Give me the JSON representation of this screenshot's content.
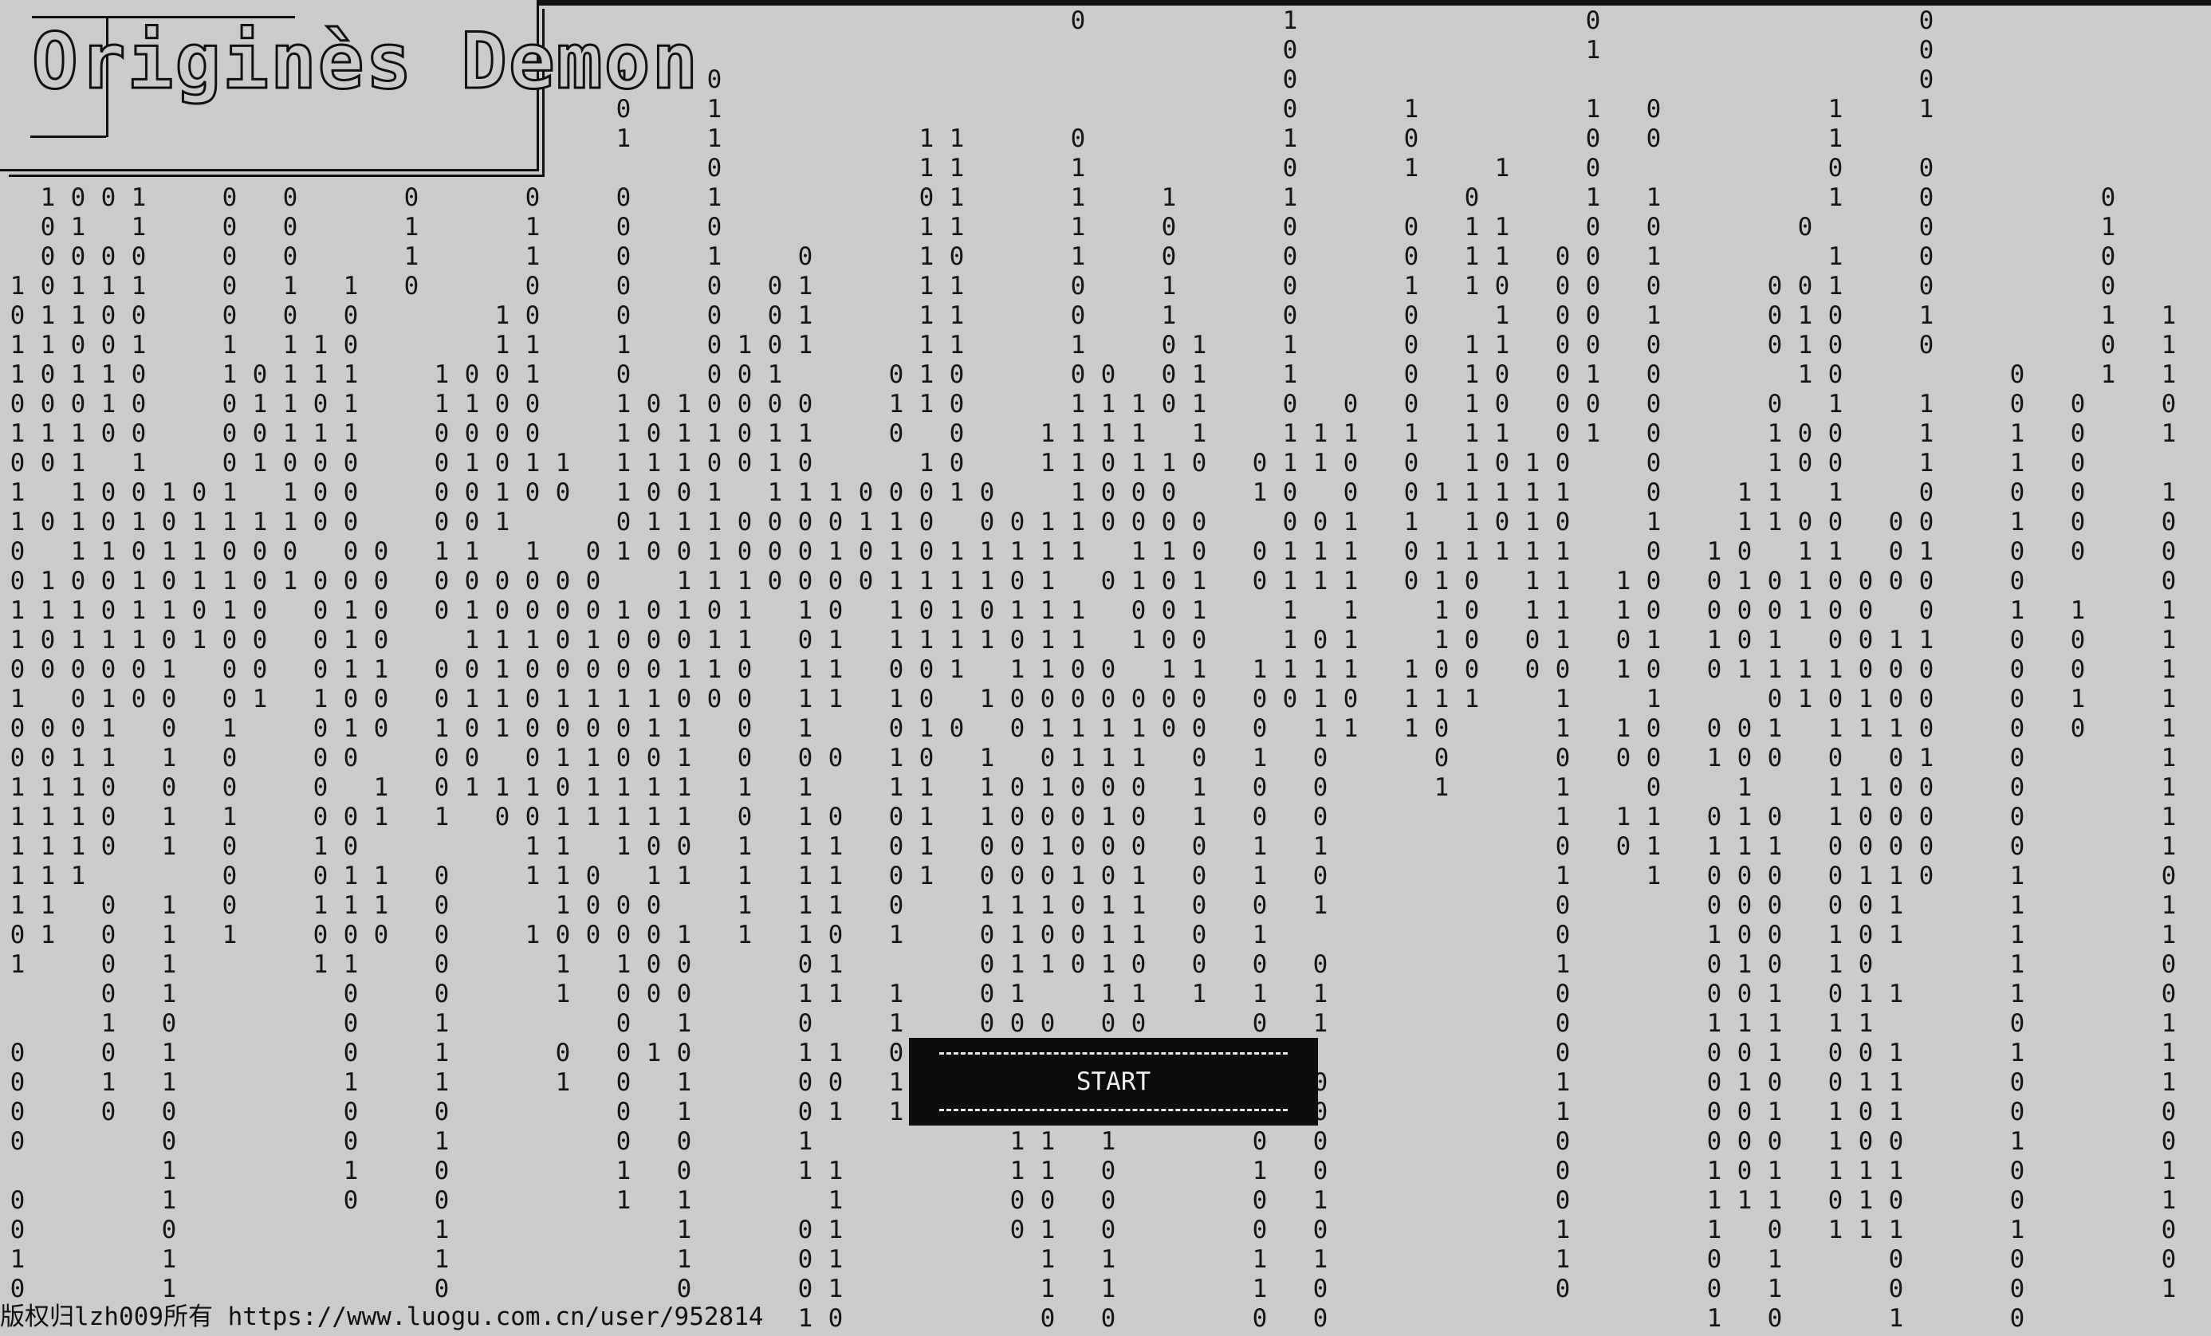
{
  "game": {
    "title": "Originès Demon",
    "start_label": "START",
    "copyright": "版权归lzh009所有 https://www.luogu.com.cn/user/952814"
  },
  "digit_rain": {
    "characters": [
      "0",
      "1"
    ]
  },
  "colors": {
    "background": "#cbcbcb",
    "foreground": "#111111",
    "button_background": "#0d0d0d",
    "button_text": "#f0f0f0"
  }
}
